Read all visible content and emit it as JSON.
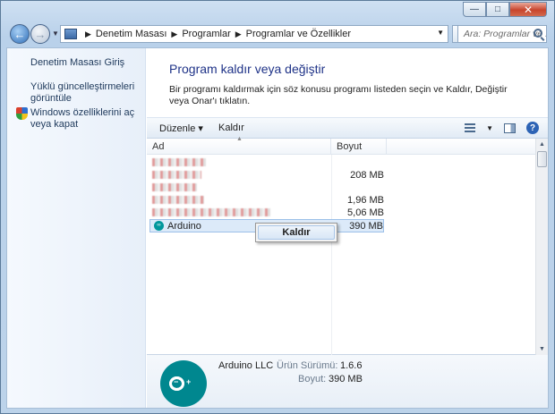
{
  "window": {
    "caption": {
      "minimize": "—",
      "maximize": "□",
      "close": "✕"
    }
  },
  "nav": {
    "back_glyph": "←",
    "forward_glyph": "→",
    "breadcrumbs": [
      "Denetim Masası",
      "Programlar",
      "Programlar ve Özellikler"
    ],
    "search_placeholder": "Ara: Programlar ve ..."
  },
  "sidebar": {
    "items": [
      {
        "label": "Denetim Masası Giriş"
      },
      {
        "label": "Yüklü güncelleştirmeleri görüntüle"
      },
      {
        "label": "Windows özelliklerini aç veya kapat",
        "icon": "shield-icon"
      }
    ]
  },
  "main": {
    "title": "Program kaldır veya değiştir",
    "description": "Bir programı kaldırmak için söz konusu programı listeden seçin ve Kaldır, Değiştir veya Onar'ı tıklatın."
  },
  "toolbar": {
    "organize": "Düzenle ▾",
    "uninstall": "Kaldır",
    "help": "?"
  },
  "list": {
    "columns": [
      "Ad",
      "Boyut"
    ],
    "rows": [
      {
        "name": "",
        "size": ""
      },
      {
        "name": "",
        "size": "208 MB"
      },
      {
        "name": "",
        "size": ""
      },
      {
        "name": "",
        "size": "1,96 MB"
      },
      {
        "name": "",
        "size": "5,06 MB"
      },
      {
        "name": "Arduino",
        "size": "390 MB",
        "selected": true
      }
    ]
  },
  "context_menu": {
    "item": "Kaldır"
  },
  "details": {
    "publisher": "Arduino LLC",
    "version_label": "Ürün Sürümü:",
    "version_value": "1.6.6",
    "size_label": "Boyut:",
    "size_value": "390 MB",
    "logo_glyph": "∞"
  },
  "colors": {
    "accent": "#1e3287",
    "arduino": "#00878f"
  }
}
